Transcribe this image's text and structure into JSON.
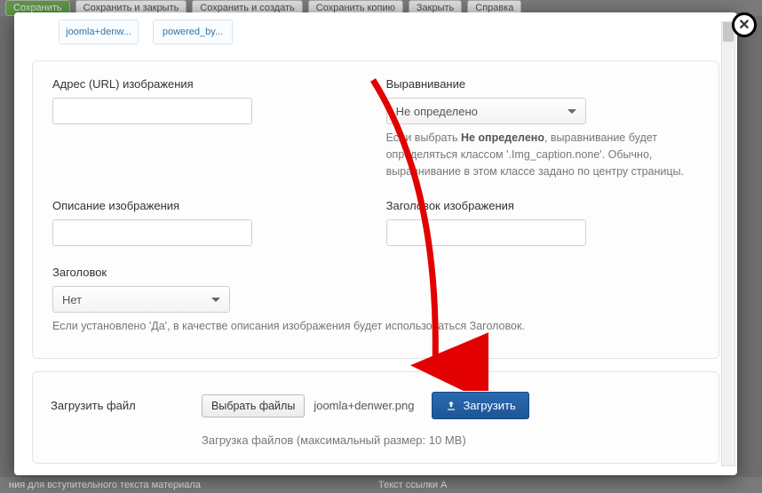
{
  "bg_toolbar": {
    "save": "Сохранить",
    "save_close": "Сохранить и закрыть",
    "save_new": "Сохранить и создать",
    "save_copy": "Сохранить копию",
    "close": "Закрыть",
    "help": "Справка"
  },
  "bg_bottom": {
    "left": "ния для вступительного текста материала",
    "right": "Текст ссылки А"
  },
  "thumbs": [
    "joomla+denw...",
    "powered_by..."
  ],
  "fields": {
    "url_label": "Адрес (URL) изображения",
    "align_label": "Выравнивание",
    "align_value": "Не определено",
    "align_help_1": "Если выбрать ",
    "align_help_bold": "Не определено",
    "align_help_2": ", выравнивание будет определяться классом '.Img_caption.none'. Обычно, выравнивание в этом классе задано по центру страницы.",
    "desc_label": "Описание изображения",
    "title_label": "Заголовок изображения",
    "caption_label": "Заголовок",
    "caption_value": "Нет",
    "caption_help": "Если установлено 'Да', в качестве описания изображения будет использоваться Заголовок."
  },
  "upload": {
    "label": "Загрузить файл",
    "browse_btn": "Выбрать файлы",
    "file_name": "joomla+denwer.png",
    "upload_btn": "Загрузить",
    "note": "Загрузка файлов (максимальный размер: 10 MB)"
  }
}
